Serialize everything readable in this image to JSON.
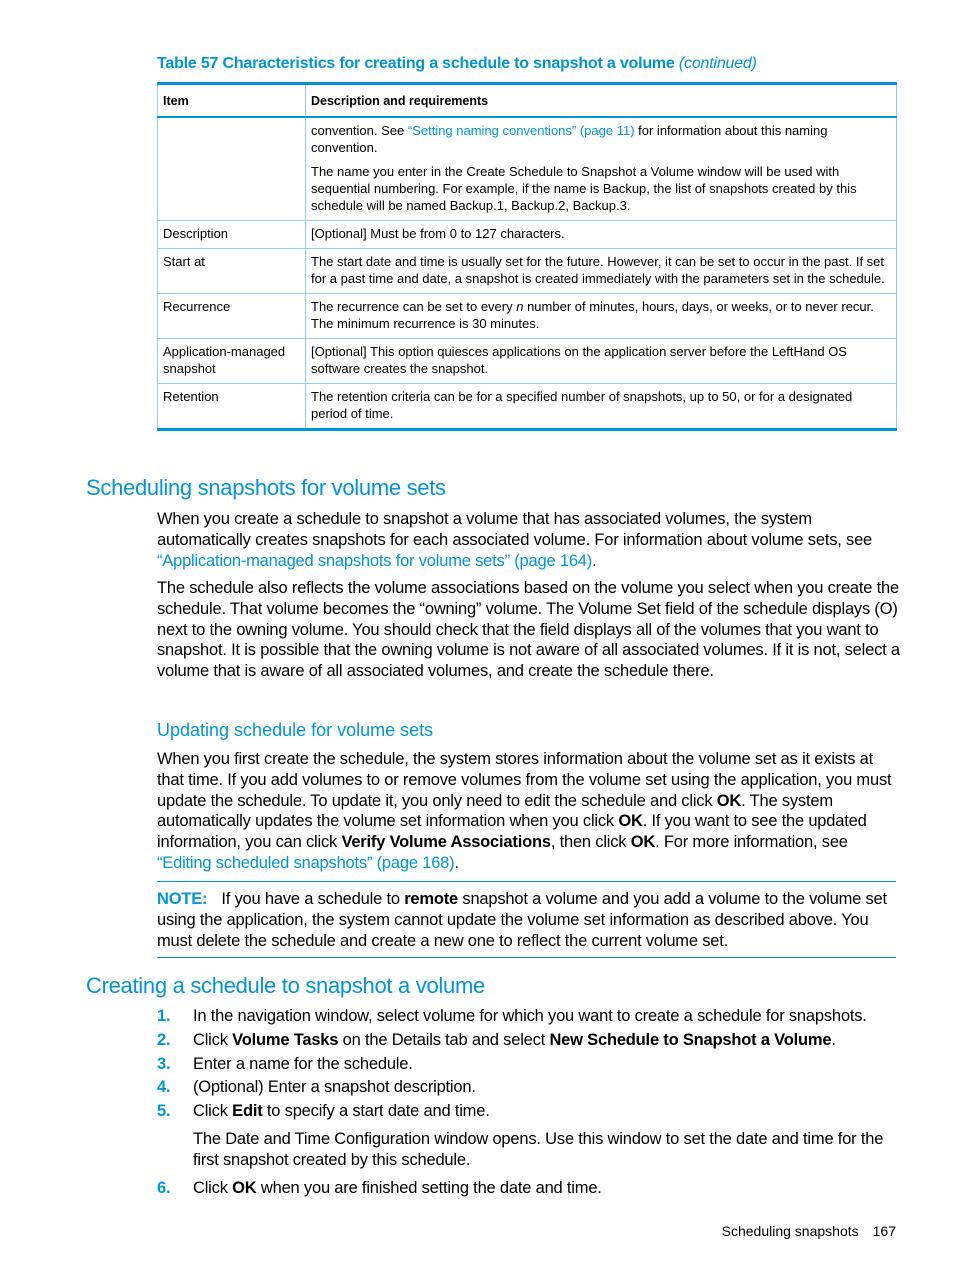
{
  "table": {
    "caption": "Table 57 Characteristics for creating a schedule to snapshot a volume",
    "caption_suffix": "(continued)",
    "headers": [
      "Item",
      "Description and requirements"
    ],
    "row0": {
      "item": "",
      "p1_pre": "convention. See ",
      "p1_link": "“Setting naming conventions” (page 11)",
      "p1_post": " for information about this naming convention.",
      "p2": "The name you enter in the Create Schedule to Snapshot a Volume window will be used with sequential numbering. For example, if the name is Backup, the list of snapshots created by this schedule will be named Backup.1, Backup.2, Backup.3."
    },
    "row1": {
      "item": "Description",
      "desc": "[Optional] Must be from 0 to 127 characters."
    },
    "row2": {
      "item": "Start at",
      "desc": "The start date and time is usually set for the future. However, it can be set to occur in the past. If set for a past time and date, a snapshot is created immediately with the parameters set in the schedule."
    },
    "row3": {
      "item": "Recurrence",
      "desc_pre": "The recurrence can be set to every ",
      "desc_italic": "n",
      "desc_post": " number of minutes, hours, days, or weeks, or to never recur. The minimum recurrence is 30 minutes."
    },
    "row4": {
      "item": "Application-managed snapshot",
      "desc": "[Optional] This option quiesces applications on the application server before the LeftHand OS software creates the snapshot."
    },
    "row5": {
      "item": "Retention",
      "desc": "The retention criteria can be for a specified number of snapshots, up to 50, or for a designated period of time."
    }
  },
  "section1": {
    "title": "Scheduling snapshots for volume sets",
    "p1_pre": "When you create a schedule to snapshot a volume that has associated volumes, the system automatically creates snapshots for each associated volume. For information about volume sets, see ",
    "p1_link": "“Application-managed snapshots for volume sets” (page 164)",
    "p1_post": ".",
    "p2": "The schedule also reflects the volume associations based on the volume you select when you create the schedule. That volume becomes the “owning” volume. The Volume Set field of the schedule displays (O) next to the owning volume. You should check that the field displays all of the volumes that you want to snapshot. It is possible that the owning volume is not aware of all associated volumes. If it is not, select a volume that is aware of all associated volumes, and create the schedule there."
  },
  "subsection": {
    "title": "Updating schedule for volume sets",
    "t1": "When you first create the schedule, the system stores information about the volume set as it exists at that time. If you add volumes to or remove volumes from the volume set using the application, you must update the schedule. To update it, you only need to edit the schedule and click ",
    "b1": "OK",
    "t2": ". The system automatically updates the volume set information when you click ",
    "b2": "OK",
    "t3": ". If you want to see the updated information, you can click ",
    "b3": "Verify Volume Associations",
    "t4": ", then click ",
    "b4": "OK",
    "t5": ". For more information, see ",
    "link": "“Editing scheduled snapshots” (page 168)",
    "t6": "."
  },
  "note": {
    "label": "NOTE:",
    "t1": "If you have a schedule to ",
    "b1": "remote",
    "t2": " snapshot a volume and you add a volume to the volume set using the application, the system cannot update the volume set information as described above. You must delete the schedule and create a new one to reflect the current volume set."
  },
  "section2": {
    "title": "Creating a schedule to snapshot a volume",
    "steps": [
      {
        "num": "1.",
        "text": "In the navigation window, select volume for which you want to create a schedule for snapshots."
      },
      {
        "num": "2.",
        "t1": "Click ",
        "b1": "Volume Tasks",
        "t2": " on the Details tab and select ",
        "b2": "New Schedule to Snapshot a Volume",
        "t3": "."
      },
      {
        "num": "3.",
        "text": "Enter a name for the schedule."
      },
      {
        "num": "4.",
        "text": "(Optional) Enter a snapshot description."
      },
      {
        "num": "5.",
        "t1": "Click ",
        "b1": "Edit",
        "t2": " to specify a start date and time.",
        "sub": "The Date and Time Configuration window opens. Use this window to set the date and time for the first snapshot created by this schedule."
      },
      {
        "num": "6.",
        "t1": "Click ",
        "b1": "OK",
        "t2": " when you are finished setting the date and time."
      }
    ]
  },
  "footer": {
    "section": "Scheduling snapshots",
    "page": "167"
  }
}
